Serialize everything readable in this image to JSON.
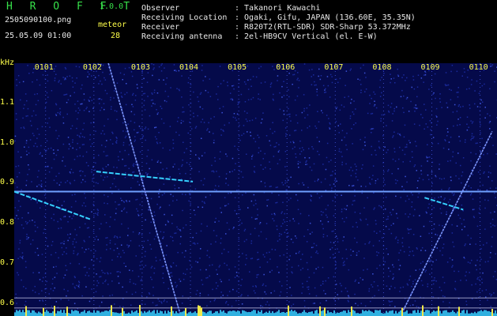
{
  "header": {
    "app_name": "H R O F F T",
    "version": "1.0.0",
    "filename": "2505090100.png",
    "datetime": "25.05.09 01:00",
    "meteor_label": "meteor",
    "meteor_count": "28",
    "info": [
      {
        "label": "Observer",
        "value": ": Takanori Kawachi"
      },
      {
        "label": "Receiving Location",
        "value": ": Ogaki, Gifu, JAPAN (136.60E, 35.35N)"
      },
      {
        "label": "Receiver",
        "value": ": R820T2(RTL-SDR) SDR-Sharp 53.372MHz"
      },
      {
        "label": "Receiving antenna",
        "value": ": 2el-HB9CV Vertical (el. E-W)"
      }
    ]
  },
  "colors": {
    "background": "#000000",
    "noise": "#1a2a9c",
    "signal": "#35d0ff",
    "text_yellow": "#ffff4a",
    "text_white": "#e8e8e8",
    "title_green": "#37e04a"
  },
  "chart_data": {
    "type": "heatmap",
    "ylabel": "kHz",
    "ylim": [
      0.57,
      1.2
    ],
    "yticks": [
      "1.1",
      "1.0",
      "0.9",
      "0.8",
      "0.7",
      "0.6"
    ],
    "xticks": [
      "0101",
      "0102",
      "0103",
      "0104",
      "0105",
      "0106",
      "0107",
      "0108",
      "0109",
      "0110"
    ],
    "xlim_minutes": [
      0,
      10
    ],
    "carrier_khz": 0.88,
    "traces": [
      {
        "kind": "steep",
        "points": [
          [
            1.95,
            1.2
          ],
          [
            3.45,
            0.57
          ]
        ]
      },
      {
        "kind": "steep",
        "points": [
          [
            8.0,
            0.57
          ],
          [
            9.9,
            1.03
          ]
        ]
      },
      {
        "kind": "slope",
        "points": [
          [
            1.7,
            0.93
          ],
          [
            3.7,
            0.905
          ]
        ]
      },
      {
        "kind": "slope",
        "points": [
          [
            0.0,
            0.88
          ],
          [
            1.6,
            0.81
          ]
        ]
      },
      {
        "kind": "slope",
        "points": [
          [
            8.5,
            0.865
          ],
          [
            9.3,
            0.835
          ]
        ]
      }
    ]
  }
}
